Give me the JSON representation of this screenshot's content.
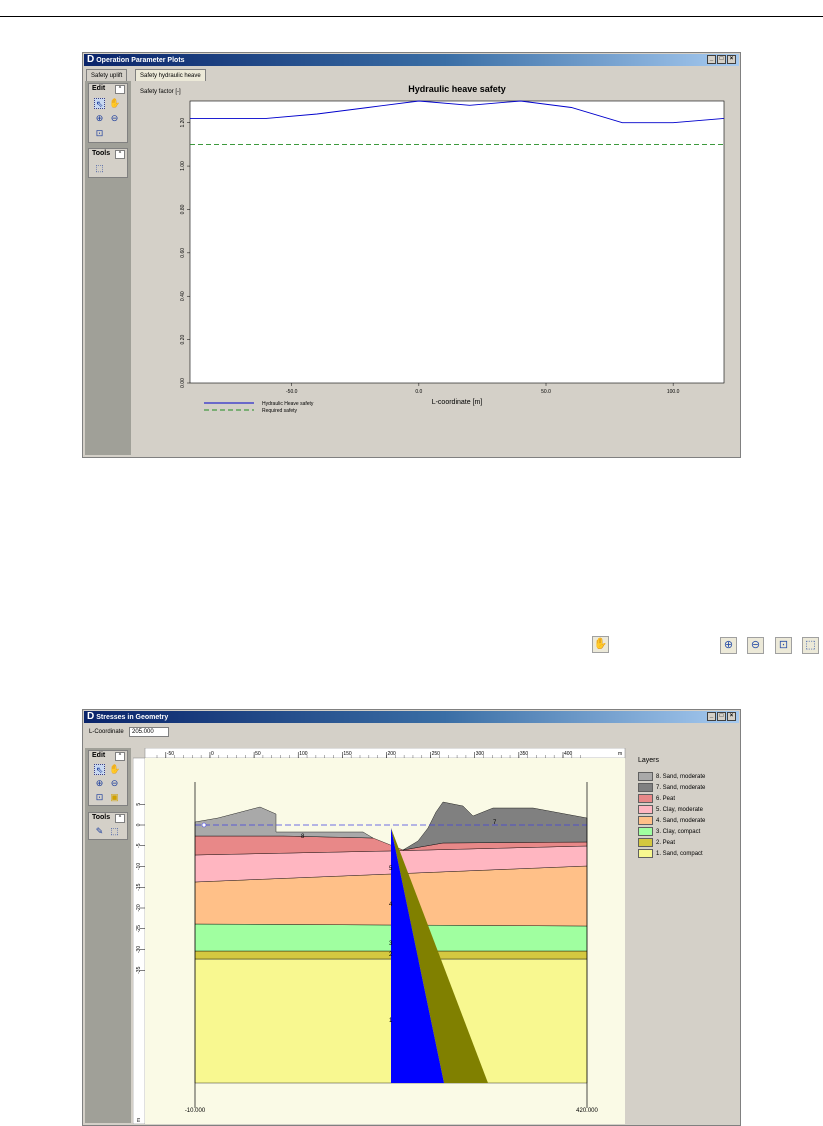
{
  "window1": {
    "title": "Operation Parameter Plots",
    "tabs": [
      "Safety uplift",
      "Safety hydraulic heave"
    ],
    "edit_label": "Edit",
    "tools_label": "Tools",
    "chart_data": {
      "type": "line",
      "title": "Hydraulic heave safety",
      "ylabel": "Safety factor [-]",
      "xlabel": "L-coordinate [m]",
      "xlim": [
        -90,
        120
      ],
      "ylim": [
        0,
        1.3
      ],
      "xticks": [
        "-50.0",
        "0.0",
        "50.0",
        "100.0"
      ],
      "yticks": [
        "0.00",
        "0.20",
        "0.40",
        "0.60",
        "0.80",
        "1.00",
        "1.20"
      ],
      "series": [
        {
          "name": "Hydraulic Heave safety",
          "color": "#0000cc",
          "style": "solid",
          "x": [
            -90,
            -60,
            -40,
            -20,
            0,
            20,
            40,
            60,
            80,
            100,
            120
          ],
          "y": [
            1.22,
            1.22,
            1.24,
            1.27,
            1.3,
            1.28,
            1.3,
            1.27,
            1.2,
            1.2,
            1.22
          ]
        },
        {
          "name": "Required safety",
          "color": "#228b22",
          "style": "dashed",
          "x": [
            -90,
            120
          ],
          "y": [
            1.1,
            1.1
          ]
        }
      ],
      "legend_position": "bottom-left",
      "grid": false
    }
  },
  "inline_icons": [
    "pan-icon",
    "zoom-in-icon",
    "zoom-out-icon",
    "zoom-rect-icon",
    "zoom-limits-icon"
  ],
  "window2": {
    "title": "Stresses in Geometry",
    "l_coordinate_label": "L-Coordinate",
    "l_coordinate_value": "205.000",
    "edit_label": "Edit",
    "tools_label": "Tools",
    "top_ruler": [
      "-50",
      "0",
      "50",
      "100",
      "150",
      "200",
      "250",
      "300",
      "350",
      "400"
    ],
    "top_ruler_unit": "m",
    "left_ruler": [
      "5",
      "0",
      "-5",
      "-10",
      "-15",
      "-20",
      "-25",
      "-30",
      "-35"
    ],
    "left_ruler_unit": "m",
    "bottom_left_label": "-10.000",
    "bottom_right_label": "420.000",
    "layer_numbers": [
      "8",
      "7",
      "5",
      "4",
      "3",
      "2",
      "1"
    ],
    "layers_title": "Layers",
    "layers": [
      {
        "label": "8. Sand, moderate",
        "color": "#a9a9a9"
      },
      {
        "label": "7. Sand, moderate",
        "color": "#808080"
      },
      {
        "label": "6. Peat",
        "color": "#e88888"
      },
      {
        "label": "5. Clay, moderate",
        "color": "#ffb6c1"
      },
      {
        "label": "4. Sand, moderate",
        "color": "#ffc088"
      },
      {
        "label": "3. Clay, compact",
        "color": "#a0ffa0"
      },
      {
        "label": "2. Peat",
        "color": "#d4c840"
      },
      {
        "label": "1. Sand, compact",
        "color": "#f8f890"
      }
    ]
  }
}
